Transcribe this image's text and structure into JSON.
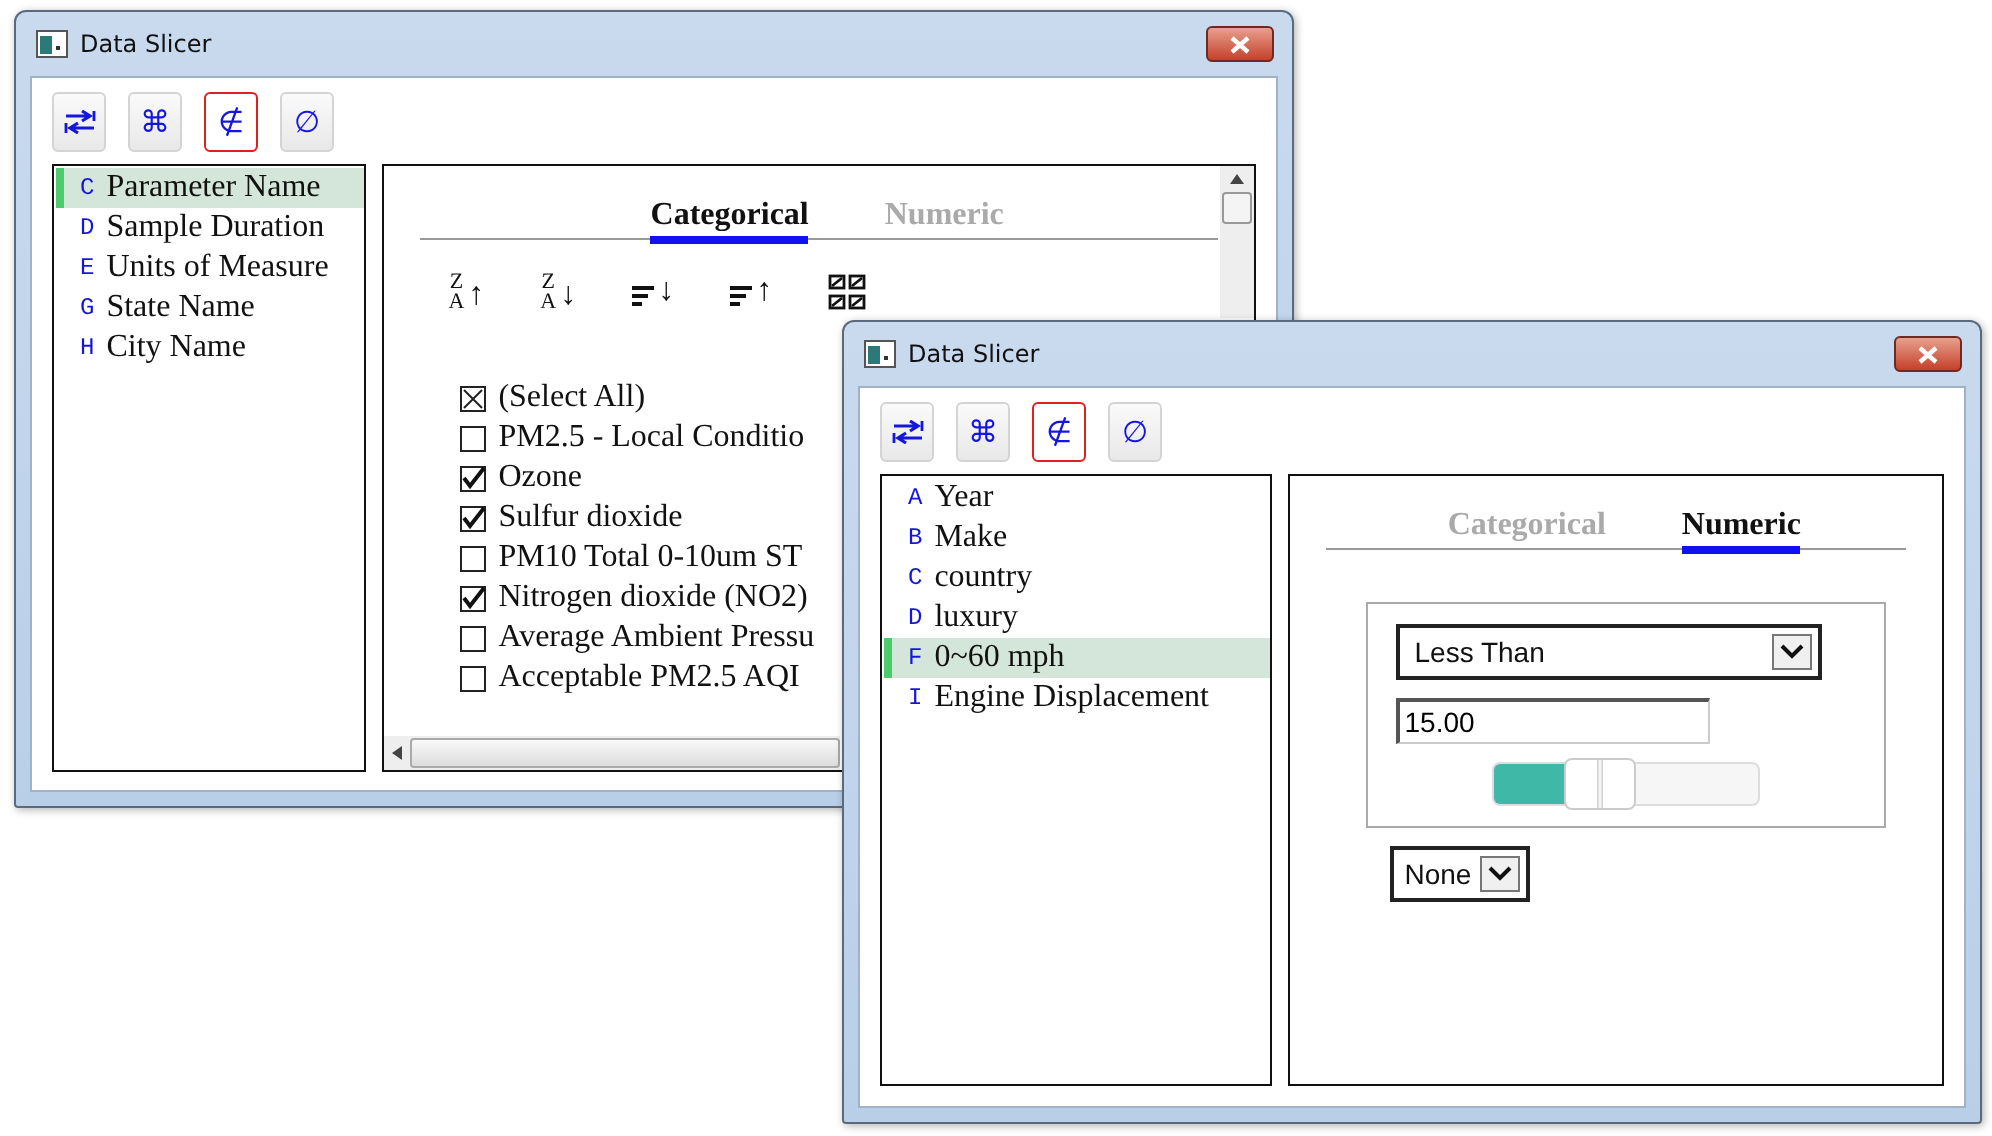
{
  "windows": [
    {
      "title": "Data Slicer",
      "toolbar": [
        {
          "kind": "swap",
          "selected": false
        },
        {
          "kind": "glyph",
          "glyph": "⌘",
          "selected": false
        },
        {
          "kind": "glyph",
          "glyph": "∉",
          "selected": true
        },
        {
          "kind": "glyph",
          "glyph": "∅",
          "selected": false
        }
      ],
      "fields": [
        {
          "letter": "C",
          "name": "Parameter Name",
          "selected": true
        },
        {
          "letter": "D",
          "name": "Sample Duration",
          "selected": false
        },
        {
          "letter": "E",
          "name": "Units of Measure",
          "selected": false
        },
        {
          "letter": "G",
          "name": "State Name",
          "selected": false
        },
        {
          "letter": "H",
          "name": "City Name",
          "selected": false
        }
      ],
      "tabs": [
        {
          "label": "Categorical",
          "selected": true
        },
        {
          "label": "Numeric",
          "selected": false
        }
      ],
      "sort_buttons": [
        {
          "kind": "alpha",
          "top": "Z",
          "bottom": "A",
          "arrow": "↑"
        },
        {
          "kind": "alpha",
          "top": "Z",
          "bottom": "A",
          "arrow": "↓"
        },
        {
          "kind": "bars",
          "arrow": "↓"
        },
        {
          "kind": "bars",
          "arrow": "↑"
        },
        {
          "kind": "grid"
        }
      ],
      "values": [
        {
          "label": "(Select All)",
          "checked": false,
          "indeterminate": true
        },
        {
          "label": "PM2.5 - Local Conditio",
          "checked": false,
          "indeterminate": false
        },
        {
          "label": "Ozone",
          "checked": true,
          "indeterminate": false
        },
        {
          "label": "Sulfur dioxide",
          "checked": true,
          "indeterminate": false
        },
        {
          "label": "PM10 Total 0-10um ST",
          "checked": false,
          "indeterminate": false
        },
        {
          "label": "Nitrogen dioxide (NO2)",
          "checked": true,
          "indeterminate": false
        },
        {
          "label": "Average Ambient Pressu",
          "checked": false,
          "indeterminate": false
        },
        {
          "label": "Acceptable PM2.5 AQI",
          "checked": false,
          "indeterminate": false
        }
      ]
    },
    {
      "title": "Data Slicer",
      "toolbar": [
        {
          "kind": "swap",
          "selected": false
        },
        {
          "kind": "glyph",
          "glyph": "⌘",
          "selected": false
        },
        {
          "kind": "glyph",
          "glyph": "∉",
          "selected": true
        },
        {
          "kind": "glyph",
          "glyph": "∅",
          "selected": false
        }
      ],
      "fields": [
        {
          "letter": "A",
          "name": "Year",
          "selected": false
        },
        {
          "letter": "B",
          "name": "Make",
          "selected": false
        },
        {
          "letter": "C",
          "name": "country",
          "selected": false
        },
        {
          "letter": "D",
          "name": "luxury",
          "selected": false
        },
        {
          "letter": "F",
          "name": "0~60 mph",
          "selected": true
        },
        {
          "letter": "I",
          "name": "Engine Displacement",
          "selected": false
        }
      ],
      "tabs": [
        {
          "label": "Categorical",
          "selected": false
        },
        {
          "label": "Numeric",
          "selected": true
        }
      ],
      "filter": {
        "operator": "Less Than",
        "value": "15.00",
        "level": 0.4,
        "combine": "None"
      }
    }
  ]
}
